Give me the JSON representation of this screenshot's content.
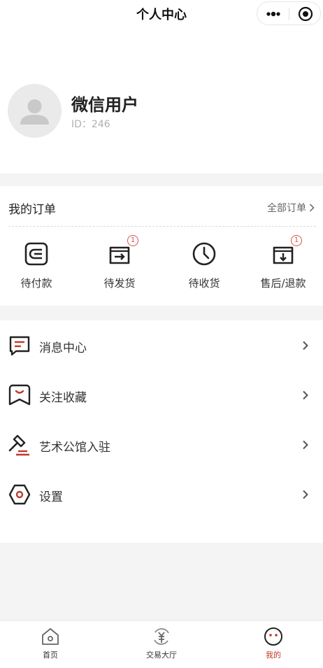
{
  "nav": {
    "title": "个人中心"
  },
  "profile": {
    "name": "微信用户",
    "id_text": "ID：246"
  },
  "orders": {
    "title": "我的订单",
    "all_label": "全部订单",
    "items": [
      {
        "label": "待付款",
        "icon": "wallet-icon",
        "badge": ""
      },
      {
        "label": "待发货",
        "icon": "ship-icon",
        "badge": "1"
      },
      {
        "label": "待收货",
        "icon": "clock-icon",
        "badge": ""
      },
      {
        "label": "售后/退款",
        "icon": "refund-box-icon",
        "badge": "1"
      }
    ]
  },
  "menu": {
    "items": [
      {
        "label": "消息中心",
        "icon": "message-icon"
      },
      {
        "label": "关注收藏",
        "icon": "favorite-icon"
      },
      {
        "label": "艺术公馆入驻",
        "icon": "auction-hammer-icon"
      },
      {
        "label": "设置",
        "icon": "settings-hexagon-icon"
      }
    ]
  },
  "tabbar": {
    "items": [
      {
        "label": "首页",
        "icon": "home-icon"
      },
      {
        "label": "交易大厅",
        "icon": "trade-hall-icon"
      },
      {
        "label": "我的",
        "icon": "profile-face-icon"
      }
    ]
  },
  "colors": {
    "accent": "#c0392b",
    "badge": "#d9534f",
    "text": "#222222",
    "background": "#f4f4f4"
  }
}
